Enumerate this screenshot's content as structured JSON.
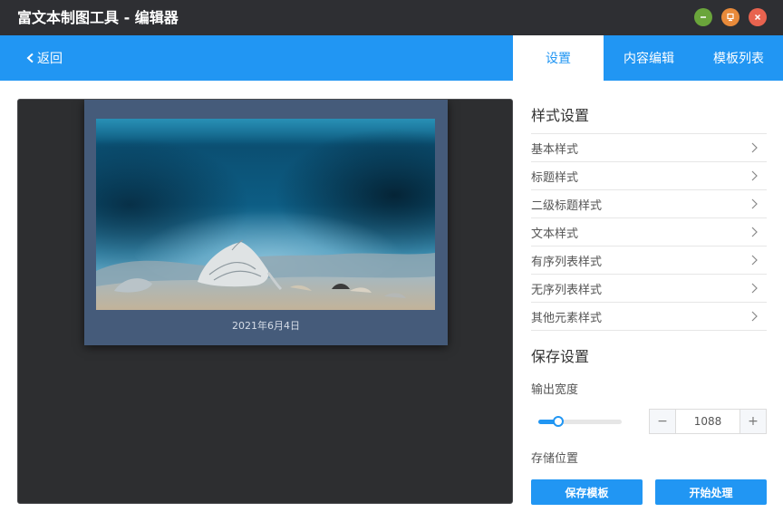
{
  "window": {
    "title": "富文本制图工具 - 编辑器",
    "controls": {
      "minimize": "minimize-icon",
      "maximize": "maximize-icon",
      "close": "close-icon"
    },
    "colors": {
      "minimize": "#6aa53b",
      "maximize": "#e88a3a",
      "close": "#e8634f"
    }
  },
  "header": {
    "back_label": "返回",
    "tabs": [
      {
        "label": "设置",
        "active": true
      },
      {
        "label": "内容编辑",
        "active": false
      },
      {
        "label": "模板列表",
        "active": false
      }
    ],
    "accent": "#2196f3"
  },
  "preview": {
    "date": "2021年6月4日",
    "image": "underwater-seashell-photo"
  },
  "panel": {
    "style_title": "样式设置",
    "style_items": [
      {
        "label": "基本样式"
      },
      {
        "label": "标题样式"
      },
      {
        "label": "二级标题样式"
      },
      {
        "label": "文本样式"
      },
      {
        "label": "有序列表样式"
      },
      {
        "label": "无序列表样式"
      },
      {
        "label": "其他元素样式"
      }
    ],
    "save_title": "保存设置",
    "output_width_label": "输出宽度",
    "slider_level": 0.24,
    "width_value": "1088",
    "minus_label": "−",
    "plus_label": "+",
    "storage_label": "存储位置",
    "save_template_label": "保存模板",
    "start_label": "开始处理"
  }
}
